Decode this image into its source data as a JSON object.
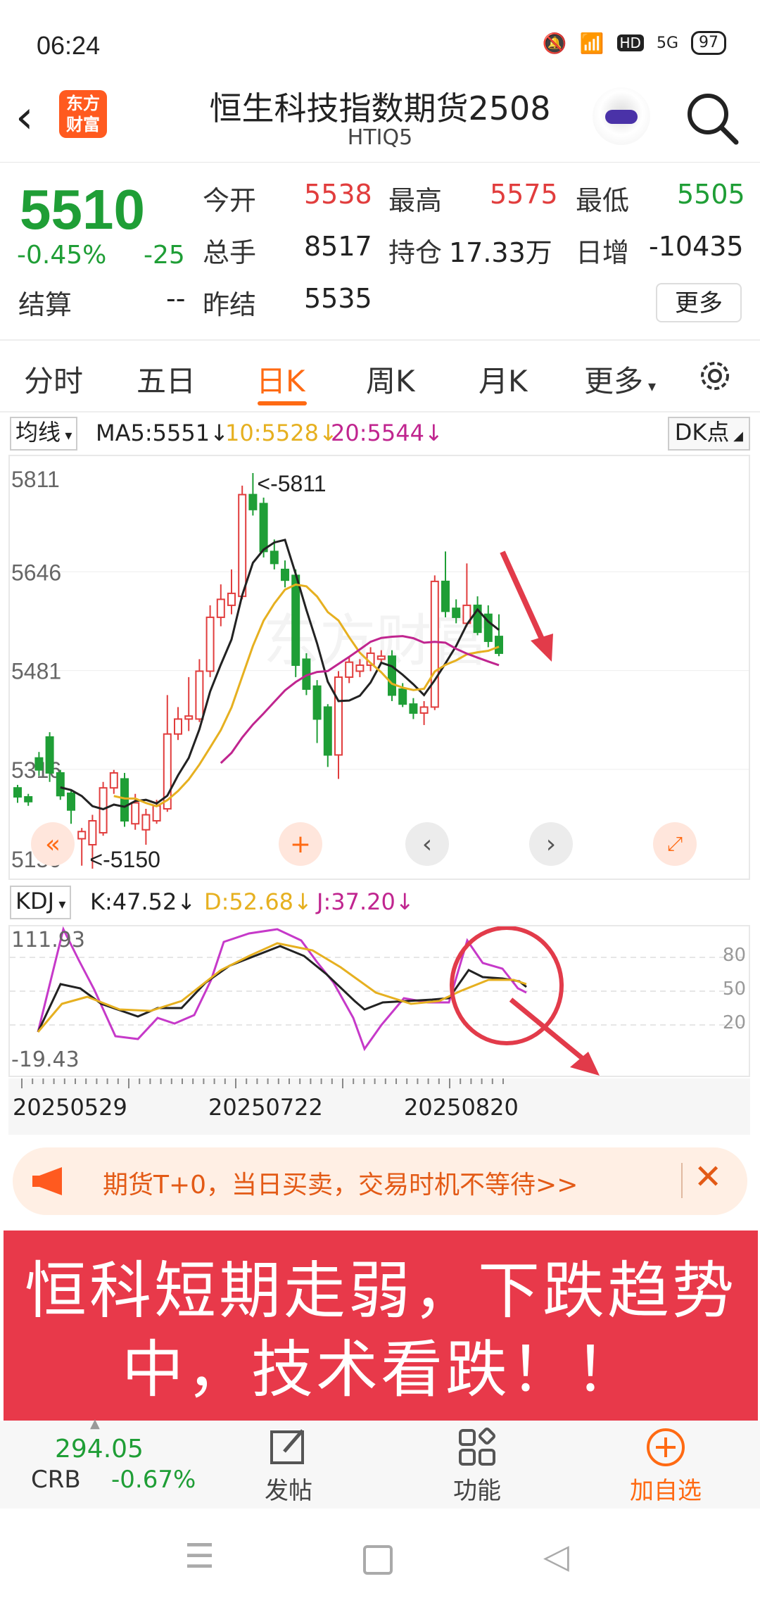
{
  "status": {
    "time": "06:24",
    "signal": "5G",
    "battery": "97"
  },
  "header": {
    "logo_line1": "东方",
    "logo_line2": "财富",
    "title": "恒生科技指数期货2508",
    "code": "HTIQ5"
  },
  "quote": {
    "price": "5510",
    "change_pct": "-0.45%",
    "change": "-25",
    "settle_label": "结算",
    "settle_val": "--",
    "open_label": "今开",
    "open_val": "5538",
    "high_label": "最高",
    "high_val": "5575",
    "low_label": "最低",
    "low_val": "5505",
    "vol_label": "总手",
    "vol_val": "8517",
    "oi_label": "持仓",
    "oi_val": "17.33万",
    "daily_label": "日增",
    "daily_val": "-10435",
    "prev_label": "昨结",
    "prev_val": "5535",
    "more": "更多"
  },
  "tabs": [
    "分时",
    "五日",
    "日K",
    "周K",
    "月K",
    "更多"
  ],
  "active_tab": "日K",
  "ma": {
    "button": "均线",
    "ma5": "MA5:5551↓",
    "ma10": "10:5528↓",
    "ma20": "20:5544↓",
    "dk": "DK点"
  },
  "kdj": {
    "button": "KDJ",
    "k": "K:47.52↓",
    "d": "D:52.68↓",
    "j": "J:37.20↓",
    "top": "111.93",
    "bottom": "-19.43",
    "l80": "80",
    "l50": "50",
    "l20": "20"
  },
  "chart_data": {
    "type": "candlestick",
    "y_ticks": [
      "5811",
      "5646",
      "5481",
      "5316",
      "5150"
    ],
    "ylim": [
      5150,
      5811
    ],
    "max_label": "<-5811",
    "min_label": "<-5150",
    "dates": [
      "20250529",
      "20250722",
      "20250820"
    ],
    "candles": [
      {
        "o": 5285,
        "c": 5270,
        "h": 5290,
        "l": 5260
      },
      {
        "o": 5270,
        "c": 5262,
        "h": 5275,
        "l": 5255
      },
      {
        "o": 5335,
        "c": 5315,
        "h": 5345,
        "l": 5305
      },
      {
        "o": 5370,
        "c": 5310,
        "h": 5378,
        "l": 5295
      },
      {
        "o": 5310,
        "c": 5272,
        "h": 5315,
        "l": 5265
      },
      {
        "o": 5276,
        "c": 5248,
        "h": 5282,
        "l": 5225
      },
      {
        "o": 5200,
        "c": 5212,
        "h": 5218,
        "l": 5155
      },
      {
        "o": 5190,
        "c": 5230,
        "h": 5240,
        "l": 5150
      },
      {
        "o": 5210,
        "c": 5285,
        "h": 5295,
        "l": 5205
      },
      {
        "o": 5285,
        "c": 5310,
        "h": 5315,
        "l": 5275
      },
      {
        "o": 5300,
        "c": 5230,
        "h": 5310,
        "l": 5220
      },
      {
        "o": 5225,
        "c": 5260,
        "h": 5275,
        "l": 5215
      },
      {
        "o": 5215,
        "c": 5240,
        "h": 5250,
        "l": 5190
      },
      {
        "o": 5230,
        "c": 5255,
        "h": 5265,
        "l": 5225
      },
      {
        "o": 5250,
        "c": 5375,
        "h": 5440,
        "l": 5245
      },
      {
        "o": 5375,
        "c": 5400,
        "h": 5420,
        "l": 5365
      },
      {
        "o": 5400,
        "c": 5405,
        "h": 5470,
        "l": 5380
      },
      {
        "o": 5400,
        "c": 5480,
        "h": 5500,
        "l": 5395
      },
      {
        "o": 5480,
        "c": 5570,
        "h": 5590,
        "l": 5470
      },
      {
        "o": 5570,
        "c": 5600,
        "h": 5625,
        "l": 5555
      },
      {
        "o": 5590,
        "c": 5610,
        "h": 5650,
        "l": 5575
      },
      {
        "o": 5605,
        "c": 5775,
        "h": 5790,
        "l": 5600
      },
      {
        "o": 5775,
        "c": 5750,
        "h": 5811,
        "l": 5740
      },
      {
        "o": 5760,
        "c": 5680,
        "h": 5770,
        "l": 5670
      },
      {
        "o": 5680,
        "c": 5660,
        "h": 5700,
        "l": 5650
      },
      {
        "o": 5650,
        "c": 5632,
        "h": 5665,
        "l": 5620
      },
      {
        "o": 5640,
        "c": 5490,
        "h": 5650,
        "l": 5470
      },
      {
        "o": 5500,
        "c": 5450,
        "h": 5510,
        "l": 5440
      },
      {
        "o": 5455,
        "c": 5400,
        "h": 5465,
        "l": 5360
      },
      {
        "o": 5420,
        "c": 5340,
        "h": 5425,
        "l": 5320
      },
      {
        "o": 5340,
        "c": 5470,
        "h": 5480,
        "l": 5300
      },
      {
        "o": 5470,
        "c": 5495,
        "h": 5505,
        "l": 5460
      },
      {
        "o": 5480,
        "c": 5490,
        "h": 5500,
        "l": 5470
      },
      {
        "o": 5490,
        "c": 5510,
        "h": 5520,
        "l": 5480
      },
      {
        "o": 5500,
        "c": 5505,
        "h": 5515,
        "l": 5495
      },
      {
        "o": 5505,
        "c": 5440,
        "h": 5515,
        "l": 5430
      },
      {
        "o": 5450,
        "c": 5425,
        "h": 5460,
        "l": 5420
      },
      {
        "o": 5425,
        "c": 5410,
        "h": 5435,
        "l": 5400
      },
      {
        "o": 5410,
        "c": 5420,
        "h": 5430,
        "l": 5390
      },
      {
        "o": 5420,
        "c": 5630,
        "h": 5640,
        "l": 5415
      },
      {
        "o": 5630,
        "c": 5580,
        "h": 5680,
        "l": 5570
      },
      {
        "o": 5585,
        "c": 5570,
        "h": 5600,
        "l": 5560
      },
      {
        "o": 5560,
        "c": 5590,
        "h": 5660,
        "l": 5555
      },
      {
        "o": 5590,
        "c": 5545,
        "h": 5605,
        "l": 5540
      },
      {
        "o": 5575,
        "c": 5530,
        "h": 5590,
        "l": 5520
      },
      {
        "o": 5538,
        "c": 5510,
        "h": 5575,
        "l": 5505
      }
    ]
  },
  "promo": {
    "text": "期货T+0，当日买卖，交易时机不等待>>"
  },
  "banner": {
    "line1": "恒科短期走弱，下跌趋势",
    "line2": "中，技术看跌！！"
  },
  "bottom": {
    "crb_val": "294.05",
    "crb_label": "CRB",
    "crb_pct": "-0.67%",
    "post": "发帖",
    "func": "功能",
    "add": "加自选"
  },
  "colors": {
    "up": "#e13d3d",
    "down": "#1f9e36",
    "accent": "#ff6a13",
    "banner": "#e8394a",
    "ma5": "#222222",
    "ma10": "#e6b020",
    "ma20": "#c0258f"
  }
}
